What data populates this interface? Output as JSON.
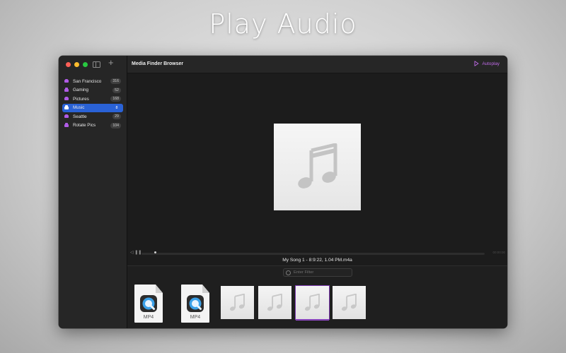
{
  "hero": {
    "title": "Play Audio"
  },
  "window": {
    "title": "Media Finder Browser",
    "autoplay_label": "Autoplay"
  },
  "sidebar": {
    "items": [
      {
        "label": "San Francisco",
        "count": "316"
      },
      {
        "label": "Gaming",
        "count": "52"
      },
      {
        "label": "Pictures",
        "count": "168"
      },
      {
        "label": "Music",
        "count": "8"
      },
      {
        "label": "Seattle",
        "count": "29"
      },
      {
        "label": "Rotate Pics",
        "count": "104"
      }
    ],
    "active_index": 3
  },
  "player": {
    "song_title": "My Song 1 - 8:9:22, 1.04 PM.m4a",
    "time": "00:00:00",
    "progress": 0.04
  },
  "filter": {
    "placeholder": "Enter Filter"
  },
  "thumbnails": [
    {
      "type": "video",
      "ext": "MP4"
    },
    {
      "type": "video",
      "ext": "MP4"
    },
    {
      "type": "audio"
    },
    {
      "type": "audio"
    },
    {
      "type": "audio",
      "selected": true
    },
    {
      "type": "audio"
    }
  ],
  "colors": {
    "accent": "#2a62d6",
    "autoplay": "#c06be8",
    "drive_icon": "#b05be6",
    "selection": "#7d3bb0"
  },
  "icons": {
    "artwork": "music-note-icon",
    "video": "quicktime-icon"
  }
}
